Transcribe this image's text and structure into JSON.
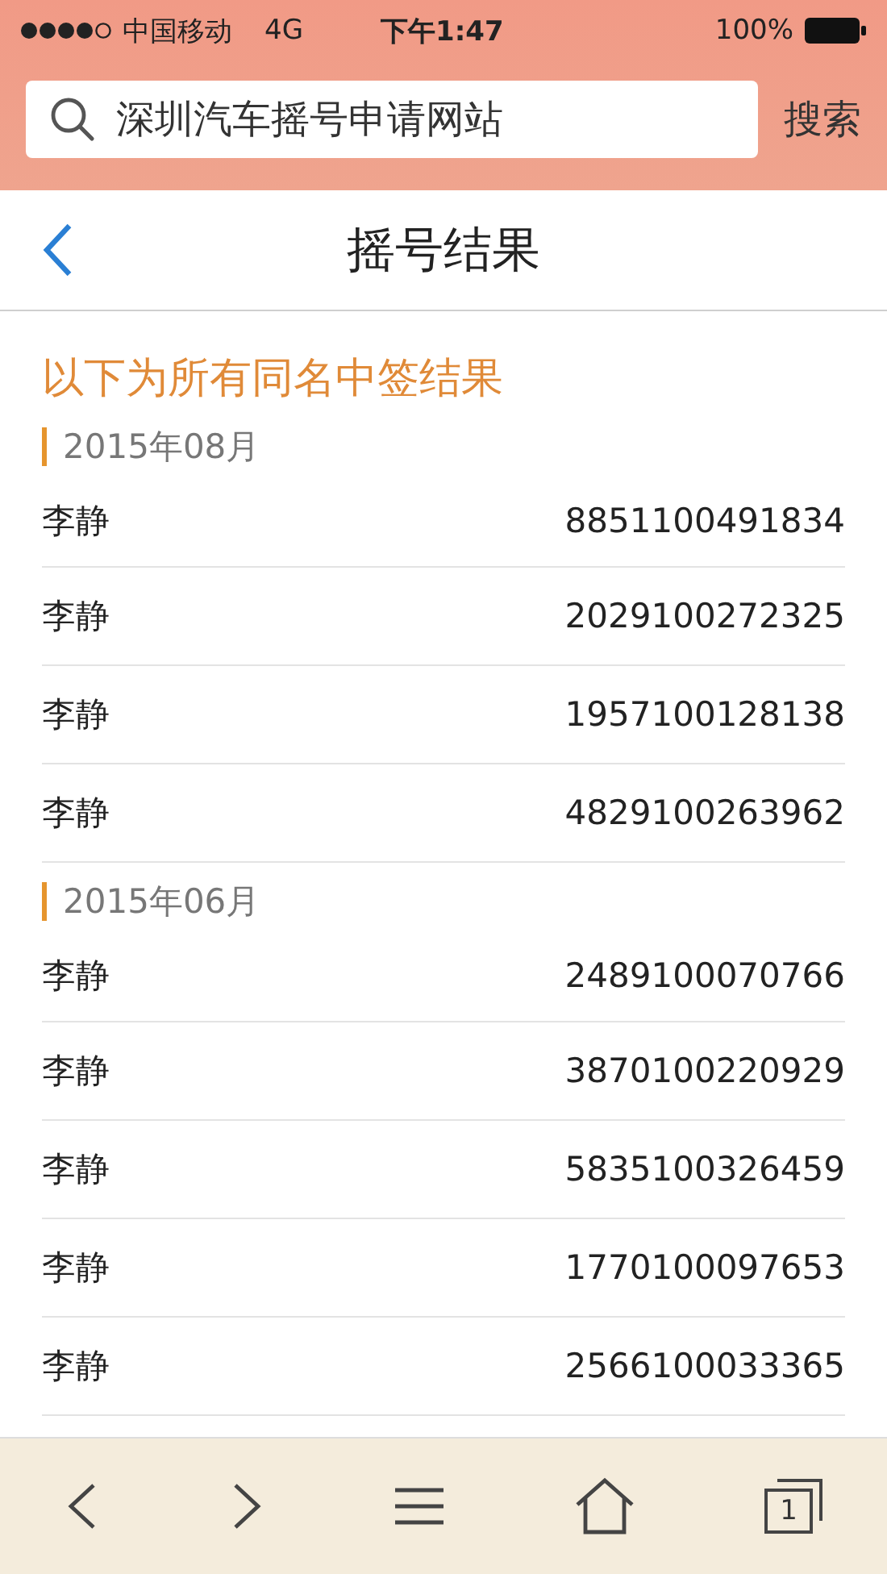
{
  "status_bar": {
    "carrier": "中国移动",
    "network": "4G",
    "time": "下午1:47",
    "battery": "100%"
  },
  "search": {
    "value": "深圳汽车摇号申请网站",
    "button": "搜索"
  },
  "nav": {
    "title": "摇号结果"
  },
  "heading": "以下为所有同名中签结果",
  "groups": [
    {
      "month": "2015年08月",
      "rows": [
        {
          "name": "李静",
          "code": "8851100491834"
        },
        {
          "name": "李静",
          "code": "2029100272325"
        },
        {
          "name": "李静",
          "code": "1957100128138"
        },
        {
          "name": "李静",
          "code": "4829100263962"
        }
      ]
    },
    {
      "month": "2015年06月",
      "rows": [
        {
          "name": "李静",
          "code": "2489100070766"
        },
        {
          "name": "李静",
          "code": "3870100220929"
        },
        {
          "name": "李静",
          "code": "5835100326459"
        },
        {
          "name": "李静",
          "code": "1770100097653"
        },
        {
          "name": "李静",
          "code": "2566100033365"
        }
      ]
    }
  ],
  "toolbar": {
    "tab_count": "1"
  }
}
